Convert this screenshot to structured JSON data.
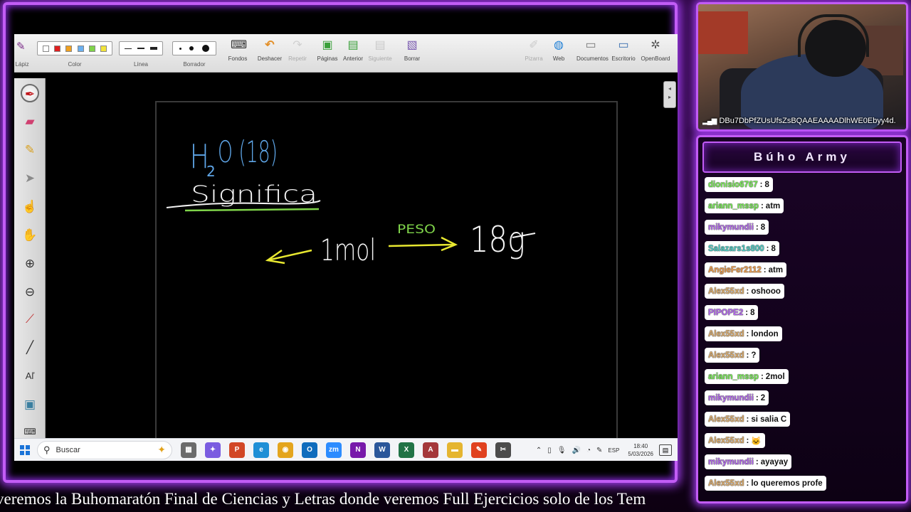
{
  "toolbar": {
    "groups": [
      {
        "id": "lapiz",
        "label": "Lápiz"
      },
      {
        "id": "color",
        "label": "Color"
      },
      {
        "id": "linea",
        "label": "Línea"
      },
      {
        "id": "borrador",
        "label": "Borrador"
      }
    ],
    "buttons": [
      {
        "label": "Fondos",
        "icon": "keyboard-icon"
      },
      {
        "label": "Deshacer",
        "icon": "undo-icon"
      },
      {
        "label": "Repetir",
        "icon": "redo-icon",
        "disabled": true
      },
      {
        "label": "Páginas",
        "icon": "pages-icon"
      },
      {
        "label": "Anterior",
        "icon": "previous-page-icon"
      },
      {
        "label": "Siguiente",
        "icon": "next-page-icon",
        "disabled": true
      },
      {
        "label": "Borrar",
        "icon": "clear-icon"
      }
    ],
    "right_buttons": [
      {
        "label": "Pizarra",
        "icon": "whiteboard-icon",
        "disabled": true
      },
      {
        "label": "Web",
        "icon": "web-icon"
      },
      {
        "label": "Documentos",
        "icon": "documents-icon"
      },
      {
        "label": "Escritorio",
        "icon": "desktop-icon"
      },
      {
        "label": "OpenBoard",
        "icon": "openboard-icon"
      }
    ],
    "colors": [
      "#ffffff",
      "#e02020",
      "#f0a020",
      "#6ab0f0",
      "#7fd34a",
      "#f2e43a"
    ]
  },
  "whiteboard": {
    "formula_main": "H",
    "formula_sub": "2",
    "formula_rest": "O (18)",
    "word": "Significa",
    "left_value": "1mol",
    "arrow_label": "PESO",
    "right_value": "18g",
    "ink_colors": {
      "blue": "#5fa6e8",
      "white": "#f4f4f4",
      "green": "#7fd34a",
      "yellow": "#e8e830"
    }
  },
  "taskbar": {
    "search_placeholder": "Buscar",
    "apps": [
      {
        "name": "task-view",
        "color": "#6b6b6b",
        "text": "▦"
      },
      {
        "name": "copilot",
        "color": "#7a5ce0",
        "text": "✦"
      },
      {
        "name": "powerpoint-red",
        "color": "#d24726",
        "text": "P"
      },
      {
        "name": "edge",
        "color": "#1f8fd6",
        "text": "e"
      },
      {
        "name": "chrome",
        "color": "#e4a51d",
        "text": "◉"
      },
      {
        "name": "outlook",
        "color": "#0f6cbd",
        "text": "O"
      },
      {
        "name": "zoom",
        "color": "#2d8cff",
        "text": "zm"
      },
      {
        "name": "onenote",
        "color": "#7719aa",
        "text": "N"
      },
      {
        "name": "word",
        "color": "#2b579a",
        "text": "W"
      },
      {
        "name": "excel",
        "color": "#217346",
        "text": "X"
      },
      {
        "name": "access",
        "color": "#a4373a",
        "text": "A"
      },
      {
        "name": "file-explorer",
        "color": "#e5b530",
        "text": "▬"
      },
      {
        "name": "pdf-reader",
        "color": "#e0411f",
        "text": "✎"
      },
      {
        "name": "snipping",
        "color": "#4c4c4c",
        "text": "✂"
      }
    ],
    "lang": "ESP",
    "time": "18:40",
    "date": "5/03/2026"
  },
  "webcam": {
    "id_text": "DBu7DbPfZUsUfsZsBQAAEAAAADlhWE0Ebyy4d."
  },
  "chat": {
    "title": "Búho Army",
    "messages": [
      {
        "user": "dionisio6767",
        "color": "#7cf05a",
        "text": "8"
      },
      {
        "user": "ariann_mssp",
        "color": "#7cf05a",
        "text": "atm"
      },
      {
        "user": "mikymundii",
        "color": "#b66cf0",
        "text": "8"
      },
      {
        "user": "Salazars1s800",
        "color": "#4fd0c8",
        "text": "8"
      },
      {
        "user": "AngieFer2112",
        "color": "#f0a050",
        "text": "atm"
      },
      {
        "user": "Alex55xd",
        "color": "#e0b070",
        "text": "oshooo"
      },
      {
        "user": "PIPOPE2",
        "color": "#b66cf0",
        "text": "8"
      },
      {
        "user": "Alex55xd",
        "color": "#e0b070",
        "text": "london"
      },
      {
        "user": "Alex55xd",
        "color": "#e0b070",
        "text": "?"
      },
      {
        "user": "ariann_mssp",
        "color": "#7cf05a",
        "text": "2mol"
      },
      {
        "user": "mikymundii",
        "color": "#b66cf0",
        "text": "2"
      },
      {
        "user": "Alex55xd",
        "color": "#e0b070",
        "text": "si salia C"
      },
      {
        "user": "Alex55xd",
        "color": "#e0b070",
        "text": "🐱"
      },
      {
        "user": "mikymundii",
        "color": "#b66cf0",
        "text": "ayayay"
      },
      {
        "user": "Alex55xd",
        "color": "#e0b070",
        "text": "lo queremos profe"
      }
    ]
  },
  "ticker": {
    "text": "veremos la Buhomaratón Final de Ciencias y Letras donde veremos Full Ejercicios solo de los Tem"
  }
}
